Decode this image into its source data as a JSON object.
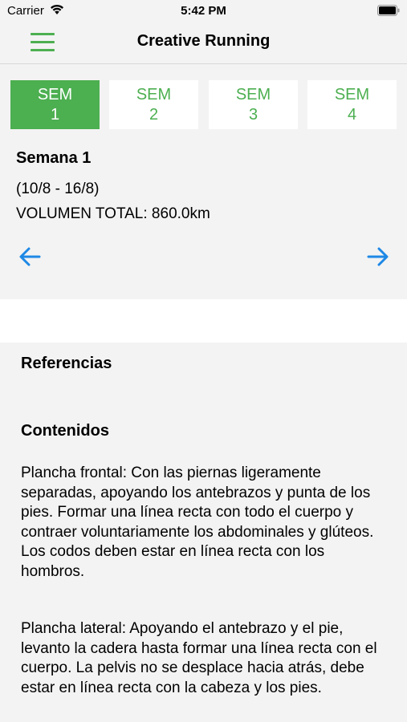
{
  "status_bar": {
    "carrier": "Carrier",
    "time": "5:42 PM"
  },
  "nav": {
    "title": "Creative Running",
    "menu_icon": "hamburger-menu-icon"
  },
  "colors": {
    "accent": "#4caf50",
    "arrow": "#1e88e5",
    "background": "#f3f3f3"
  },
  "tabs": [
    {
      "label": "SEM",
      "number": "1",
      "active": true
    },
    {
      "label": "SEM",
      "number": "2",
      "active": false
    },
    {
      "label": "SEM",
      "number": "3",
      "active": false
    },
    {
      "label": "SEM",
      "number": "4",
      "active": false
    }
  ],
  "week": {
    "title": "Semana 1",
    "dates": "(10/8 - 16/8)",
    "volume": "VOLUMEN TOTAL: 860.0km"
  },
  "navigation": {
    "prev_icon": "arrow-left-icon",
    "next_icon": "arrow-right-icon"
  },
  "sections": {
    "references_title": "Referencias",
    "contents_title": "Contenidos",
    "paragraphs": [
      "Plancha frontal: Con las piernas ligeramente separadas, apoyando los antebrazos y punta de los pies. Formar una línea recta con todo el cuerpo y contraer voluntariamente los abdominales y glúteos. Los codos deben estar en línea recta con los hombros.",
      "Plancha lateral: Apoyando el antebrazo y el pie, levanto la cadera hasta formar una línea recta con el cuerpo. La pelvis no se desplace hacia atrás, debe estar en línea recta con la cabeza y los pies."
    ]
  }
}
